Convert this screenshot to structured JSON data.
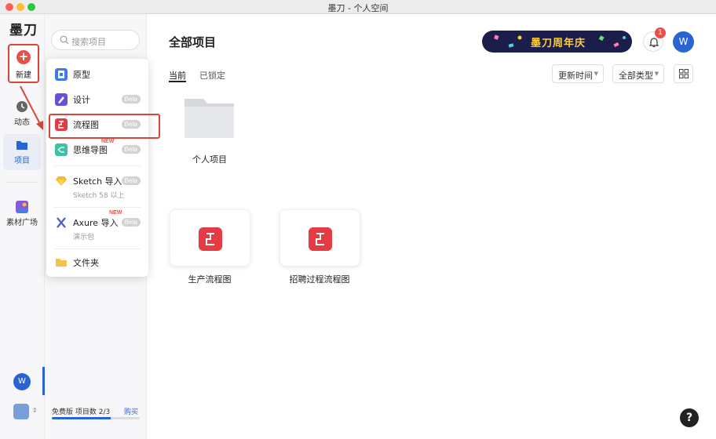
{
  "window": {
    "title": "墨刀 - 个人空间"
  },
  "rail": {
    "logo": "墨刀",
    "new_label": "新建",
    "items": [
      {
        "label": "动态",
        "icon": "clock-icon"
      },
      {
        "label": "项目",
        "icon": "folder-icon"
      },
      {
        "label": "素材广场",
        "icon": "gallery-icon"
      }
    ],
    "avatar": "W"
  },
  "sidebar": {
    "search_placeholder": "搜索项目",
    "plan_text": "免费版 项目数 2/3",
    "buy_label": "购买",
    "quota_fraction": 0.6667
  },
  "menu": {
    "items": [
      {
        "label": "原型",
        "icon": "prototype-icon",
        "beta": ""
      },
      {
        "label": "设计",
        "icon": "design-pen-icon",
        "beta": "Beta"
      },
      {
        "label": "流程图",
        "icon": "flowchart-icon",
        "beta": "Beta"
      },
      {
        "label": "思维导图",
        "icon": "mindmap-icon",
        "beta": "Beta",
        "tag": "NEW"
      },
      {
        "label": "Sketch 导入",
        "sub": "Sketch 58 以上",
        "icon": "sketch-icon",
        "beta": "Beta"
      },
      {
        "label": "Axure 导入",
        "sub": "演示包",
        "icon": "axure-icon",
        "beta": "Beta",
        "tag": "NEW"
      },
      {
        "label": "文件夹",
        "icon": "folder-yellow-icon",
        "beta": ""
      }
    ]
  },
  "main": {
    "title": "全部项目",
    "banner": "墨刀周年庆",
    "notification_count": "1",
    "avatar": "W",
    "tabs": [
      {
        "label": "当前"
      },
      {
        "label": "已锁定"
      }
    ],
    "sort_label": "更新时间",
    "type_label": "全部类型",
    "folder_label": "个人项目",
    "projects": [
      {
        "name": "生产流程图"
      },
      {
        "name": "招聘过程流程图"
      }
    ]
  },
  "help_label": "?",
  "colors": {
    "accent": "#2864d4",
    "danger": "#e8514a",
    "flowchart": "#e43b44"
  }
}
